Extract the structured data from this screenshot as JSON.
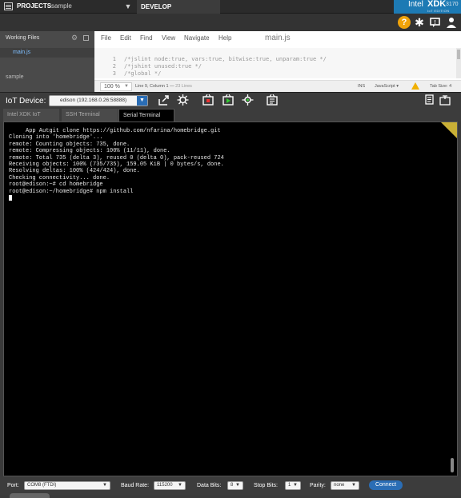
{
  "topbar": {
    "projects_label": "PROJECTS",
    "project_name": "sample",
    "develop_tab": "DEVELOP",
    "brand": {
      "intel": "Intel",
      "xdk": "XDK",
      "version": "3170",
      "edition": "IoT EDITION"
    },
    "brand_color": "#1d7ab4"
  },
  "toolbar": {
    "icons": [
      "help-icon",
      "gear-icon",
      "feedback-icon",
      "user-icon"
    ],
    "help_label": "?"
  },
  "sidebar": {
    "working_files_label": "Working Files",
    "files": [
      "main.js"
    ],
    "project_label": "sample"
  },
  "editor": {
    "menus": [
      "File",
      "Edit",
      "Find",
      "View",
      "Navigate",
      "Help"
    ],
    "filename": "main.js",
    "lines": [
      {
        "num": "1",
        "text": "/*jslint node:true, vars:true, bitwise:true, unparam:true */"
      },
      {
        "num": "2",
        "text": "/*jshint unused:true */"
      },
      {
        "num": "3",
        "text": "/*global */"
      }
    ],
    "status": {
      "zoom": "100 %",
      "position": "Line 9, Column 1 —",
      "line_count": "23 Lines",
      "ins": "INS",
      "language": "JavaScript ▾",
      "tab_size": "Tab Size: 4"
    }
  },
  "iot": {
    "label": "IoT Device:",
    "device": "edison (192.168.0.26:58888)",
    "icons": [
      "upload-icon",
      "build-icon",
      "stop-icon",
      "run-icon",
      "debug-icon",
      "manage-icon"
    ],
    "right_icons": [
      "copy-icon",
      "clear-icon"
    ]
  },
  "tabs": [
    {
      "label": "Intel XDK IoT",
      "active": false
    },
    {
      "label": "SSH Terminal",
      "active": false
    },
    {
      "label": "Serial Terminal",
      "active": true
    }
  ],
  "terminal": {
    "lines": [
      "     App Autgit clone https://github.com/nfarina/homebridge.git",
      "Cloning into 'homebridge'...",
      "remote: Counting objects: 735, done.",
      "remote: Compressing objects: 100% (11/11), done.",
      "remote: Total 735 (delta 3), reused 0 (delta 0), pack-reused 724",
      "Receiving objects: 100% (735/735), 159.05 KiB | 0 bytes/s, done.",
      "Resolving deltas: 100% (424/424), done.",
      "Checking connectivity... done.",
      "root@edison:~# cd homebridge",
      "root@edison:~/homebridge# npm install"
    ],
    "corner_color": "#c9b036"
  },
  "serial": {
    "port_label": "Port:",
    "port_value": "COM8 (FTDI)",
    "baud_label": "Baud Rate:",
    "baud_value": "115200",
    "databits_label": "Data Bits:",
    "databits_value": "8",
    "stopbits_label": "Stop Bits:",
    "stopbits_value": "1",
    "parity_label": "Parity:",
    "parity_value": "none",
    "connect_label": "Connect"
  }
}
